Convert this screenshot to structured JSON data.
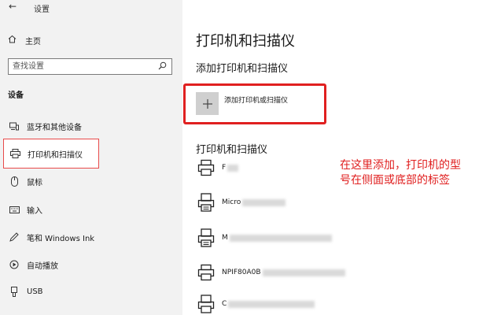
{
  "window": {
    "back_glyph": "←",
    "title": "设置"
  },
  "sidebar": {
    "home_label": "主页",
    "search_placeholder": "查找设置",
    "section_title": "设备",
    "items": [
      {
        "label": "蓝牙和其他设备",
        "icon": "bluetooth-devices-icon"
      },
      {
        "label": "打印机和扫描仪",
        "icon": "printer-icon",
        "selected": true
      },
      {
        "label": "鼠标",
        "icon": "mouse-icon"
      },
      {
        "label": "输入",
        "icon": "keyboard-icon"
      },
      {
        "label": "笔和 Windows Ink",
        "icon": "pen-icon"
      },
      {
        "label": "自动播放",
        "icon": "autoplay-icon"
      },
      {
        "label": "USB",
        "icon": "usb-icon"
      }
    ]
  },
  "main": {
    "title": "打印机和扫描仪",
    "add_section_title": "添加打印机和扫描仪",
    "add_button_label": "添加打印机或扫描仪",
    "printers_section_title": "打印机和扫描仪",
    "printers": [
      {
        "name": "F",
        "icon": "printer-icon"
      },
      {
        "name": "Micro",
        "icon": "printer-icon"
      },
      {
        "name": "M",
        "icon": "printer-icon"
      },
      {
        "name": "NPIF80A0B",
        "icon": "printer-icon"
      },
      {
        "name": "C",
        "icon": "printer-icon"
      }
    ]
  },
  "annotation": {
    "text": "在这里添加，打印机的型号在侧面或底部的标签",
    "color": "#e02020"
  },
  "colors": {
    "sidebar_bg": "#f2f2f2",
    "highlight_border": "#e02020"
  }
}
